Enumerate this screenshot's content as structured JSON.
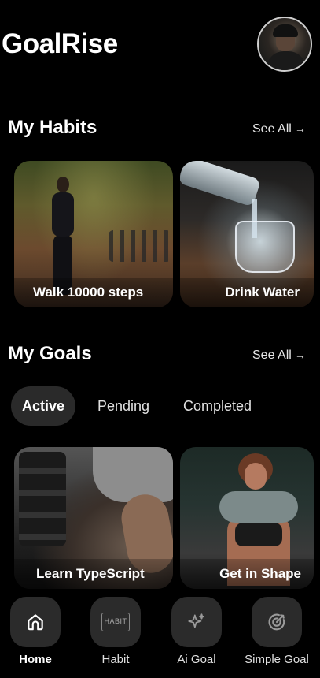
{
  "app": {
    "title": "GoalRise"
  },
  "habits": {
    "title": "My Habits",
    "see_all": "See All",
    "cards": [
      {
        "label": "Walk 10000 steps"
      },
      {
        "label": "Drink Water"
      }
    ]
  },
  "goals": {
    "title": "My Goals",
    "see_all": "See All",
    "tabs": [
      {
        "label": "Active",
        "selected": true
      },
      {
        "label": "Pending",
        "selected": false
      },
      {
        "label": "Completed",
        "selected": false
      }
    ],
    "cards": [
      {
        "label": "Learn TypeScript"
      },
      {
        "label": "Get in Shape"
      }
    ]
  },
  "nav": {
    "items": [
      {
        "label": "Home",
        "icon": "home-icon",
        "active": true
      },
      {
        "label": "Habit",
        "icon": "habit-icon",
        "badge": "HABIT",
        "active": false
      },
      {
        "label": "Ai Goal",
        "icon": "sparkle-icon",
        "active": false
      },
      {
        "label": "Simple Goal",
        "icon": "target-icon",
        "active": false
      }
    ]
  }
}
